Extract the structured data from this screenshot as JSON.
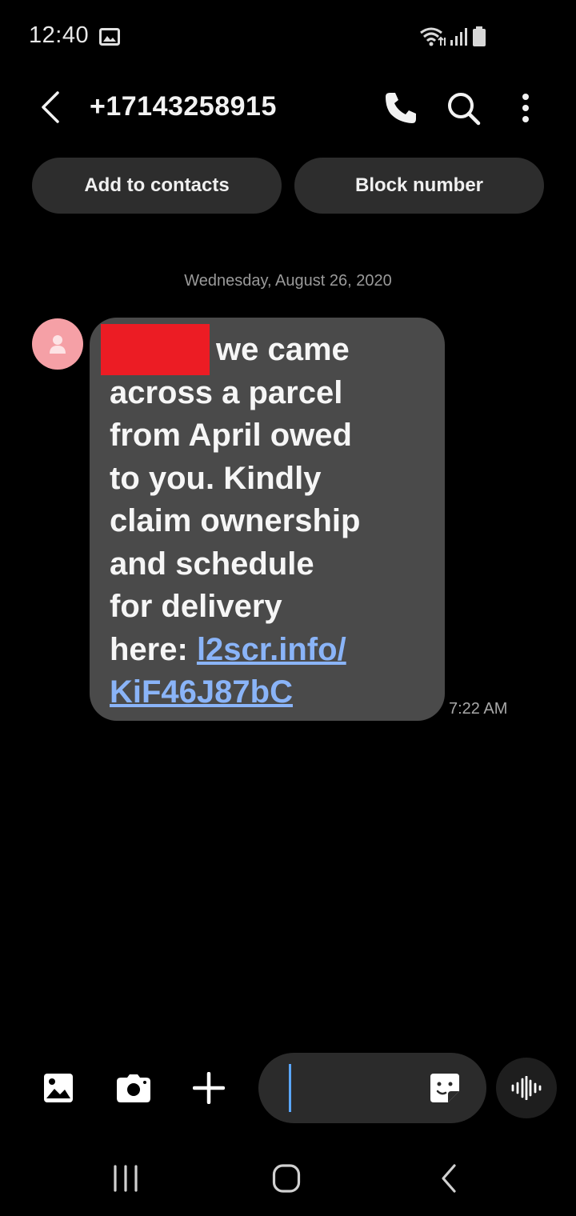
{
  "status_bar": {
    "time": "12:40",
    "icons": [
      "image-notification-icon",
      "wifi-icon",
      "signal-icon",
      "battery-icon"
    ]
  },
  "header": {
    "contact_number": "+17143258915",
    "icons": [
      "back-icon",
      "phone-icon",
      "search-icon",
      "more-vert-icon"
    ]
  },
  "actions": {
    "add_to_contacts": "Add to contacts",
    "block_number": "Block number"
  },
  "conversation": {
    "date_separator": "Wednesday, August 26, 2020",
    "message": {
      "lines": [
        "we came",
        "across a parcel",
        "from April owed",
        "to you. Kindly",
        "claim ownership",
        "and schedule",
        "for delivery"
      ],
      "last_line_prefix": "here: ",
      "link_part1": "l2scr.info/",
      "link_part2": "KiF46J87bC",
      "time": "7:22 AM",
      "redaction_color": "#ec1c24"
    }
  },
  "composer": {
    "icons": [
      "gallery-icon",
      "camera-icon",
      "add-icon",
      "sticker-icon",
      "voice-icon"
    ],
    "input_value": ""
  },
  "nav_bar": {
    "icons": [
      "recents-icon",
      "home-icon",
      "nav-back-icon"
    ]
  },
  "colors": {
    "background": "#000000",
    "bubble": "#4a4a4a",
    "pill": "#2d2d2d",
    "link": "#8ab4f8",
    "caret": "#5aa7ff",
    "avatar": "#f5a0a6"
  }
}
